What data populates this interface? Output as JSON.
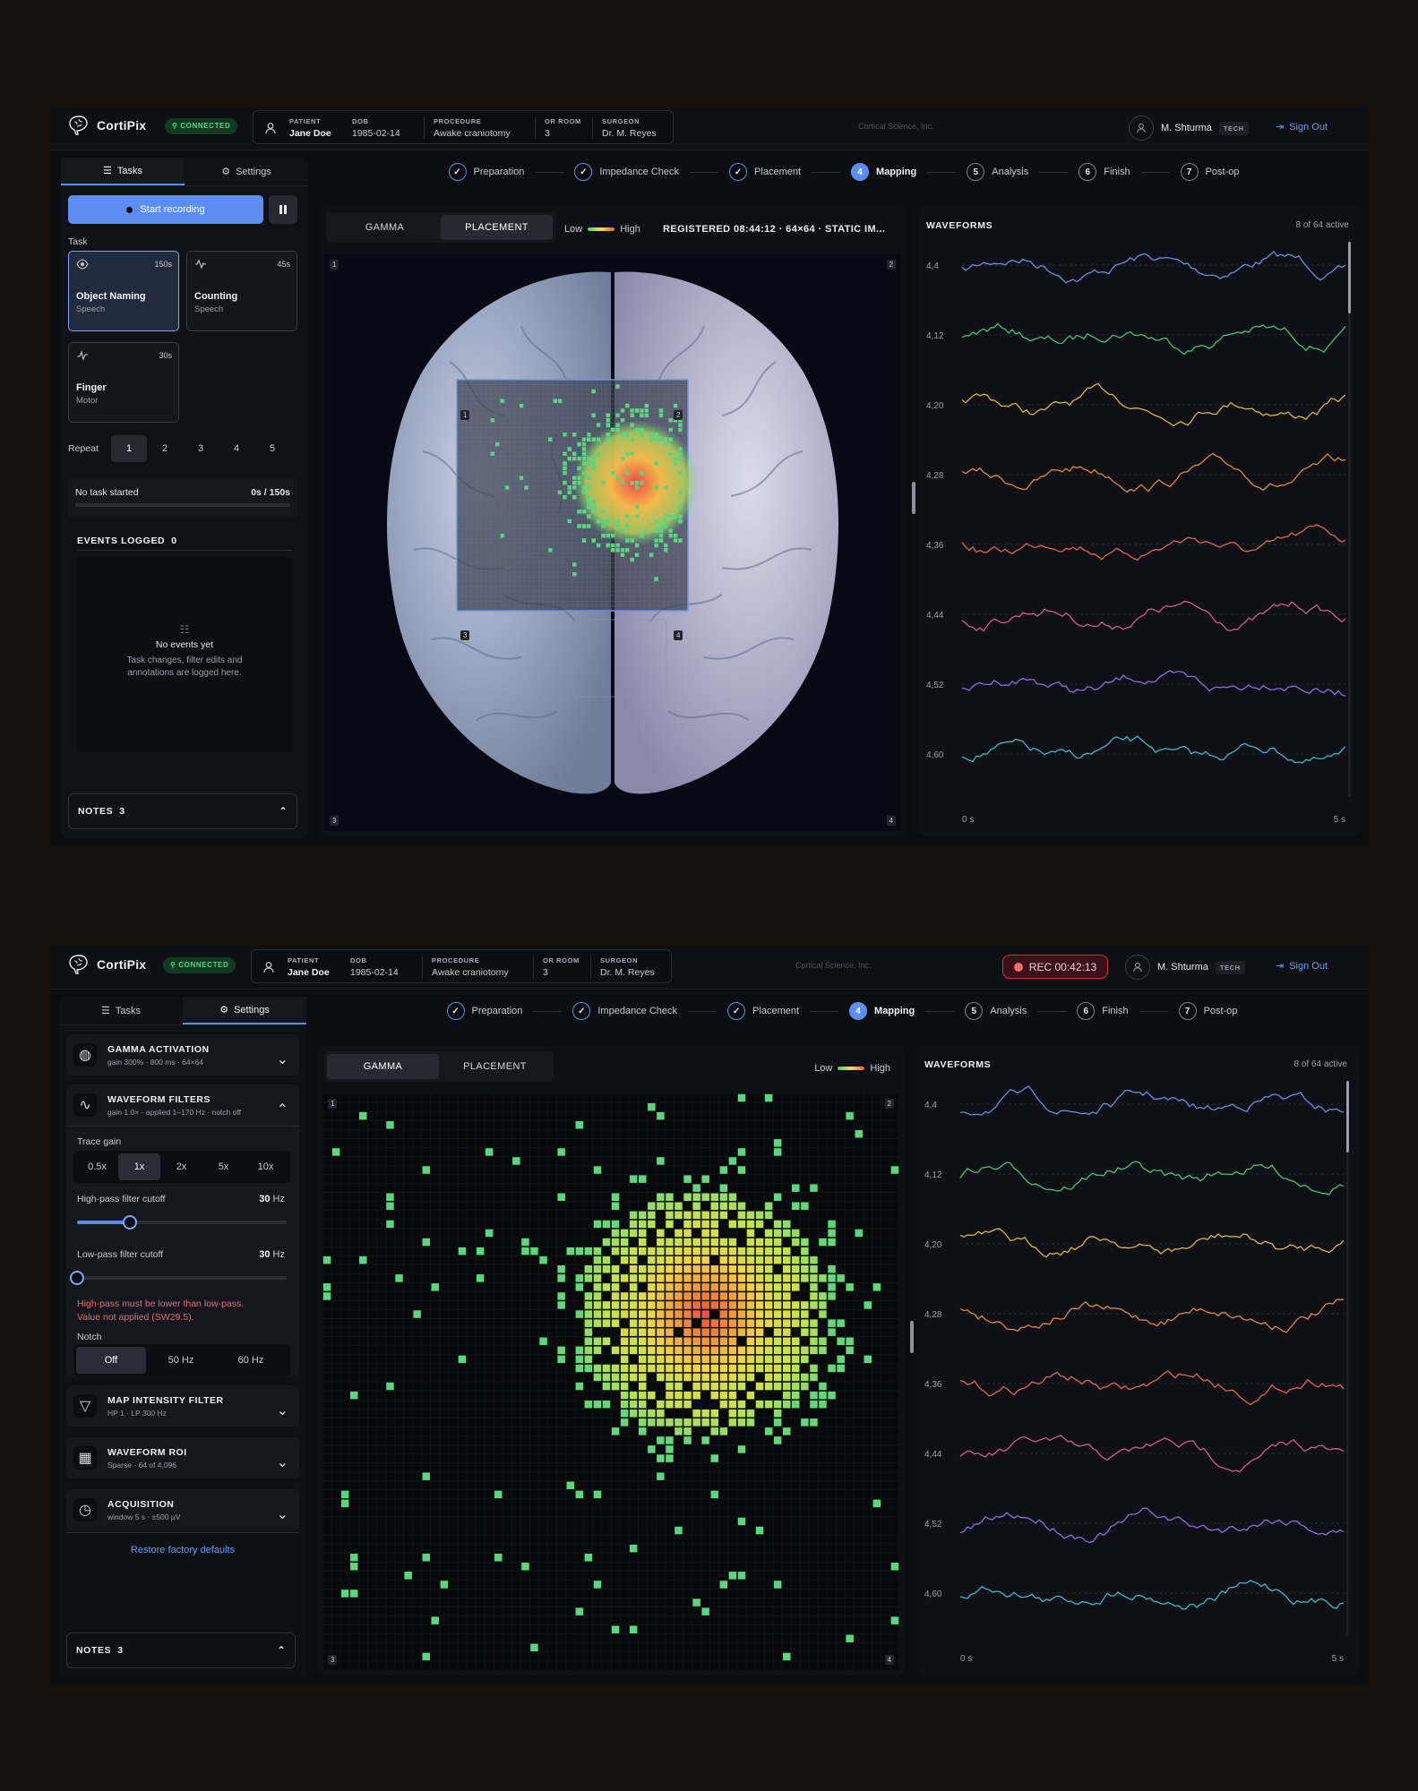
{
  "app": {
    "name": "CortiPix",
    "connection": "CONNECTED",
    "company": "Cortical Science, Inc.",
    "user": "M. Shturma",
    "role": "TECH",
    "sign_out": "Sign Out",
    "recording_badge": "REC 00:42:13"
  },
  "patient": {
    "patient_label": "PATIENT",
    "patient": "Jane Doe",
    "dob_label": "DOB",
    "dob": "1985-02-14",
    "procedure_label": "PROCEDURE",
    "procedure": "Awake craniotomy",
    "room_label": "OR ROOM",
    "room": "3",
    "surgeon_label": "SURGEON",
    "surgeon": "Dr. M. Reyes"
  },
  "steps": [
    {
      "num": "1",
      "label": "Preparation",
      "state": "done"
    },
    {
      "num": "2",
      "label": "Impedance Check",
      "state": "done"
    },
    {
      "num": "3",
      "label": "Placement",
      "state": "done"
    },
    {
      "num": "4",
      "label": "Mapping",
      "state": "current"
    },
    {
      "num": "5",
      "label": "Analysis",
      "state": "pending"
    },
    {
      "num": "6",
      "label": "Finish",
      "state": "pending"
    },
    {
      "num": "7",
      "label": "Post-op",
      "state": "pending"
    }
  ],
  "sidebar": {
    "tab_tasks": "Tasks",
    "tab_settings": "Settings",
    "start_recording": "Start recording",
    "task_label": "Task",
    "tasks": [
      {
        "name": "Object Naming",
        "category": "Speech",
        "duration": "150s",
        "icon": "eye-icon"
      },
      {
        "name": "Counting",
        "category": "Speech",
        "duration": "45s",
        "icon": "waveform-icon"
      },
      {
        "name": "Finger",
        "category": "Motor",
        "duration": "30s",
        "icon": "pulse-icon"
      }
    ],
    "repeat_label": "Repeat",
    "repeat_options": [
      "1",
      "2",
      "3",
      "4",
      "5"
    ],
    "task_status": "No task started",
    "task_progress": "0s / 150s",
    "events_label": "EVENTS LOGGED",
    "events_count": "0",
    "no_events": "No events yet",
    "no_events_desc_1": "Task changes, filter edits and",
    "no_events_desc_2": "annotations are logged here.",
    "notes_label": "NOTES",
    "notes_count": "3"
  },
  "settings": {
    "gamma": {
      "title": "GAMMA ACTIVATION",
      "subtitle": "gain 300% · 800 ms · 64×64"
    },
    "filters": {
      "title": "WAVEFORM FILTERS",
      "subtitle": "gain 1.0× · applied 1–170 Hz · notch off"
    },
    "trace_gain_label": "Trace gain",
    "trace_gain_options": [
      "0.5x",
      "1x",
      "2x",
      "5x",
      "10x"
    ],
    "highpass_label": "High-pass filter cutoff",
    "highpass_value": "30",
    "highpass_fraction": 0.25,
    "lowpass_label": "Low-pass filter cutoff",
    "lowpass_value": "30",
    "lowpass_fraction": 0.0,
    "unit_hz": "Hz",
    "error_1": "High-pass must be lower than low-pass.",
    "error_2": "Value not applied (SW29.5).",
    "notch_label": "Notch",
    "notch_options": [
      "Off",
      "50 Hz",
      "60 Hz"
    ],
    "map_intensity": {
      "title": "MAP INTENSITY FILTER",
      "subtitle": "HP 1 · LP 300 Hz"
    },
    "roi": {
      "title": "WAVEFORM ROI",
      "subtitle": "Sparse · 64 of 4,096"
    },
    "acquisition": {
      "title": "ACQUISITION",
      "subtitle": "window 5 s · ±500 µV"
    },
    "restore": "Restore factory defaults"
  },
  "map": {
    "tab_gamma": "GAMMA",
    "tab_placement": "PLACEMENT",
    "legend_low": "Low",
    "legend_high": "High",
    "registered": "REGISTERED 08:44:12  ·  64×64  ·  STATIC IM...",
    "corners": [
      "1",
      "2",
      "3",
      "4"
    ]
  },
  "waveforms": {
    "title": "WAVEFORMS",
    "active": "8 of 64 active",
    "channels": [
      "4,4",
      "4,12",
      "4,20",
      "4,28",
      "4,36",
      "4,44",
      "4,52",
      "4,60"
    ],
    "colors": [
      "#6b8fe0",
      "#45c47a",
      "#d8b83e",
      "#e08a3c",
      "#e0645c",
      "#d45c8c",
      "#8a6ee0",
      "#3eb8c8"
    ],
    "t_start": "0 s",
    "t_end": "5 s"
  },
  "colors": {
    "accent": "#5b8ef0",
    "connected": "#56d68a",
    "rec": "#c73a44",
    "error": "#e0707a"
  }
}
